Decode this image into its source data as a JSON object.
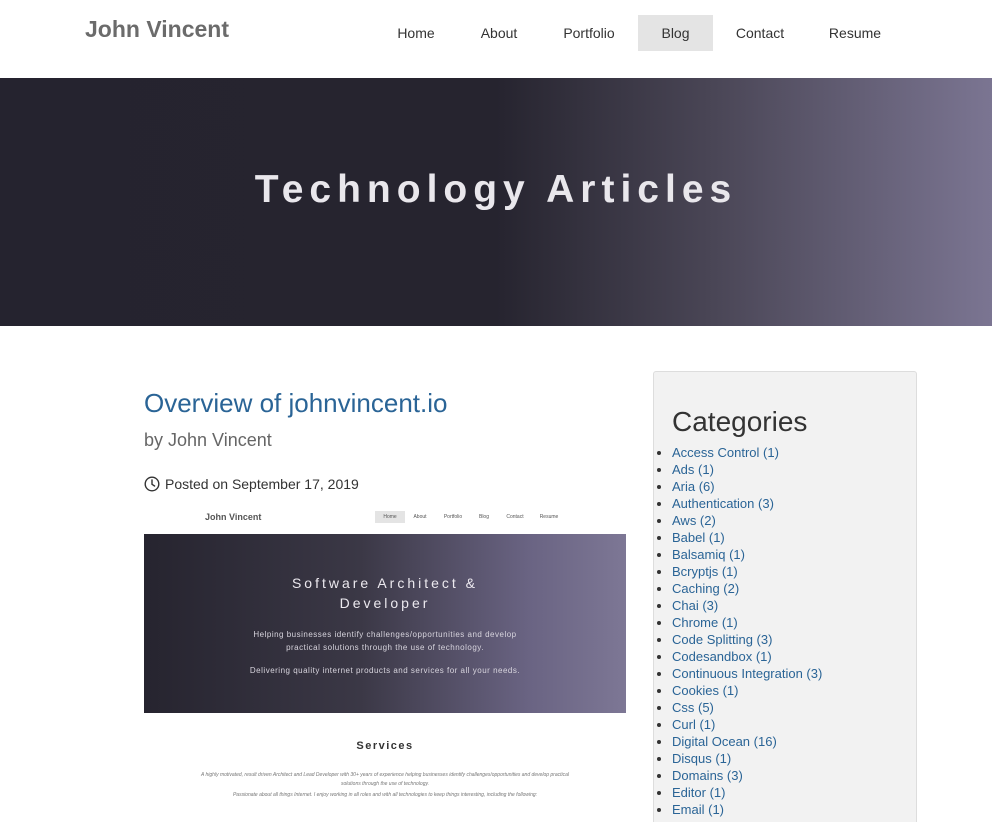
{
  "header": {
    "brand": "John Vincent",
    "nav": [
      {
        "label": "Home",
        "active": false
      },
      {
        "label": "About",
        "active": false
      },
      {
        "label": "Portfolio",
        "active": false
      },
      {
        "label": "Blog",
        "active": true
      },
      {
        "label": "Contact",
        "active": false
      },
      {
        "label": "Resume",
        "active": false
      }
    ]
  },
  "hero": {
    "title": "Technology Articles"
  },
  "post": {
    "title": "Overview of johnvincent.io",
    "author": "by John Vincent",
    "posted": "Posted on September 17, 2019",
    "thumbnail": {
      "brand": "John Vincent",
      "nav": [
        "Home",
        "About",
        "Portfolio",
        "Blog",
        "Contact",
        "Resume"
      ],
      "hero_title_line1": "Software Architect &",
      "hero_title_line2": "Developer",
      "hero_desc_line1": "Helping businesses identify challenges/opportunities and develop",
      "hero_desc_line2": "practical solutions through the use of technology.",
      "hero_deliver": "Delivering quality internet products and services for all your needs.",
      "services_heading": "Services",
      "services_p1_line1": "A highly motivated, result driven Architect and Lead Developer with 30+ years of experience helping businesses identify challenges/opportunities and develop practical",
      "services_p1_line2": "solutions through the use of technology.",
      "services_p2": "Passionate about all things Internet. I enjoy working in all roles and with all technologies to keep things interesting, including the following:"
    }
  },
  "sidebar": {
    "heading": "Categories",
    "categories": [
      "Access Control (1)",
      "Ads (1)",
      "Aria (6)",
      "Authentication (3)",
      "Aws (2)",
      "Babel (1)",
      "Balsamiq (1)",
      "Bcryptjs (1)",
      "Caching (2)",
      "Chai (3)",
      "Chrome (1)",
      "Code Splitting (3)",
      "Codesandbox (1)",
      "Continuous Integration (3)",
      "Cookies (1)",
      "Css (5)",
      "Curl (1)",
      "Digital Ocean (16)",
      "Disqus (1)",
      "Domains (3)",
      "Editor (1)",
      "Email (1)"
    ]
  },
  "colors": {
    "link": "#2a6496",
    "nav_active_bg": "#e4e4e4",
    "hero_dark": "#25232f",
    "hero_light": "#7b7592"
  }
}
